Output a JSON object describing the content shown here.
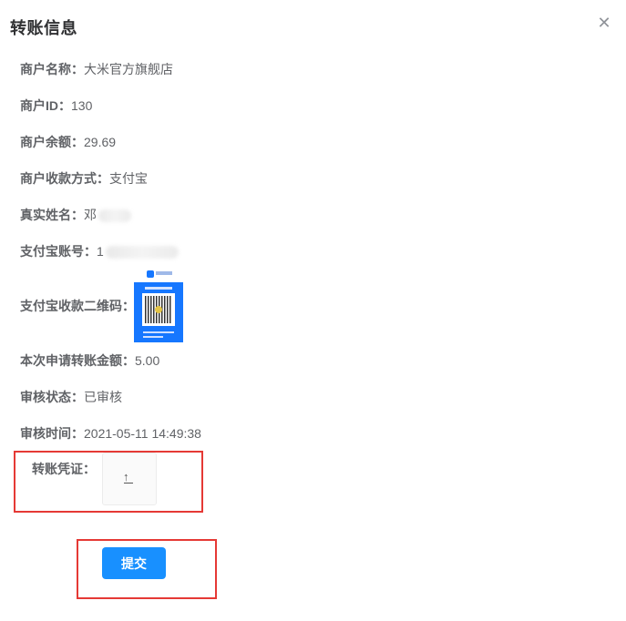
{
  "dialog": {
    "title": "转账信息",
    "close_icon": "close-icon"
  },
  "fields": {
    "merchant_name": {
      "label": "商户名称：",
      "value": "大米官方旗舰店"
    },
    "merchant_id": {
      "label": "商户ID：",
      "value": "130"
    },
    "balance": {
      "label": "商户余额：",
      "value": "29.69"
    },
    "payment_method": {
      "label": "商户收款方式：",
      "value": "支付宝"
    },
    "real_name": {
      "label": "真实姓名：",
      "value": "邓"
    },
    "alipay_account": {
      "label": "支付宝账号：",
      "value": "1"
    },
    "alipay_qr": {
      "label": "支付宝收款二维码："
    },
    "apply_amount": {
      "label": "本次申请转账金额：",
      "value": "5.00"
    },
    "review_status": {
      "label": "审核状态：",
      "value": "已审核"
    },
    "review_time": {
      "label": "审核时间：",
      "value": "2021-05-11 14:49:38"
    }
  },
  "voucher": {
    "label": "转账凭证：",
    "upload_icon": "upload-icon"
  },
  "submit": {
    "label": "提交"
  },
  "colors": {
    "primary": "#1890ff",
    "highlight": "#e53935",
    "alipay": "#1677ff"
  }
}
